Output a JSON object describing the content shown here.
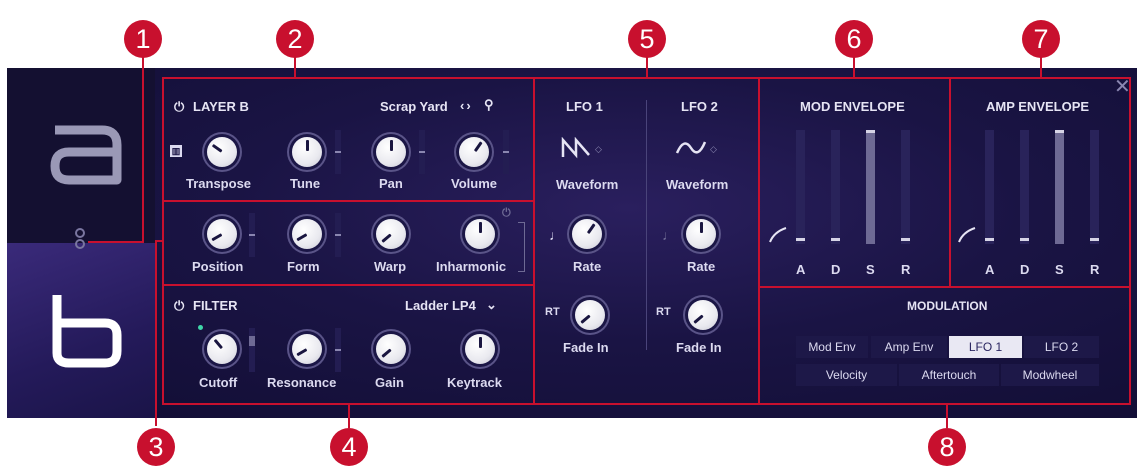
{
  "callouts": [
    "1",
    "2",
    "3",
    "4",
    "5",
    "6",
    "7",
    "8"
  ],
  "layer": {
    "title": "LAYER B",
    "preset": "Scrap Yard",
    "row1": [
      "Transpose",
      "Tune",
      "Pan",
      "Volume"
    ],
    "row2": [
      "Position",
      "Form",
      "Warp",
      "Inharmonic"
    ]
  },
  "filter": {
    "title": "FILTER",
    "type": "Ladder LP4",
    "knobs": [
      "Cutoff",
      "Resonance",
      "Gain",
      "Keytrack"
    ]
  },
  "lfo": [
    {
      "title": "LFO 1",
      "waveform_label": "Waveform",
      "rate_label": "Rate",
      "fade_label": "Fade In",
      "rt": "RT",
      "waveform_icon": "sawtooth-wave-icon"
    },
    {
      "title": "LFO 2",
      "waveform_label": "Waveform",
      "rate_label": "Rate",
      "fade_label": "Fade In",
      "rt": "RT",
      "waveform_icon": "sine-wave-icon"
    }
  ],
  "mod_envelope": {
    "title": "MOD ENVELOPE",
    "labels": [
      "A",
      "D",
      "S",
      "R"
    ]
  },
  "amp_envelope": {
    "title": "AMP ENVELOPE",
    "labels": [
      "A",
      "D",
      "S",
      "R"
    ]
  },
  "modulation": {
    "title": "MODULATION",
    "row1": [
      "Mod Env",
      "Amp Env",
      "LFO 1",
      "LFO 2"
    ],
    "row2": [
      "Velocity",
      "Aftertouch",
      "Modwheel"
    ],
    "active": "LFO 1"
  },
  "colors": {
    "accent": "#c8102e",
    "panel": "#1a1444",
    "active_button": "#e9e8f3"
  }
}
